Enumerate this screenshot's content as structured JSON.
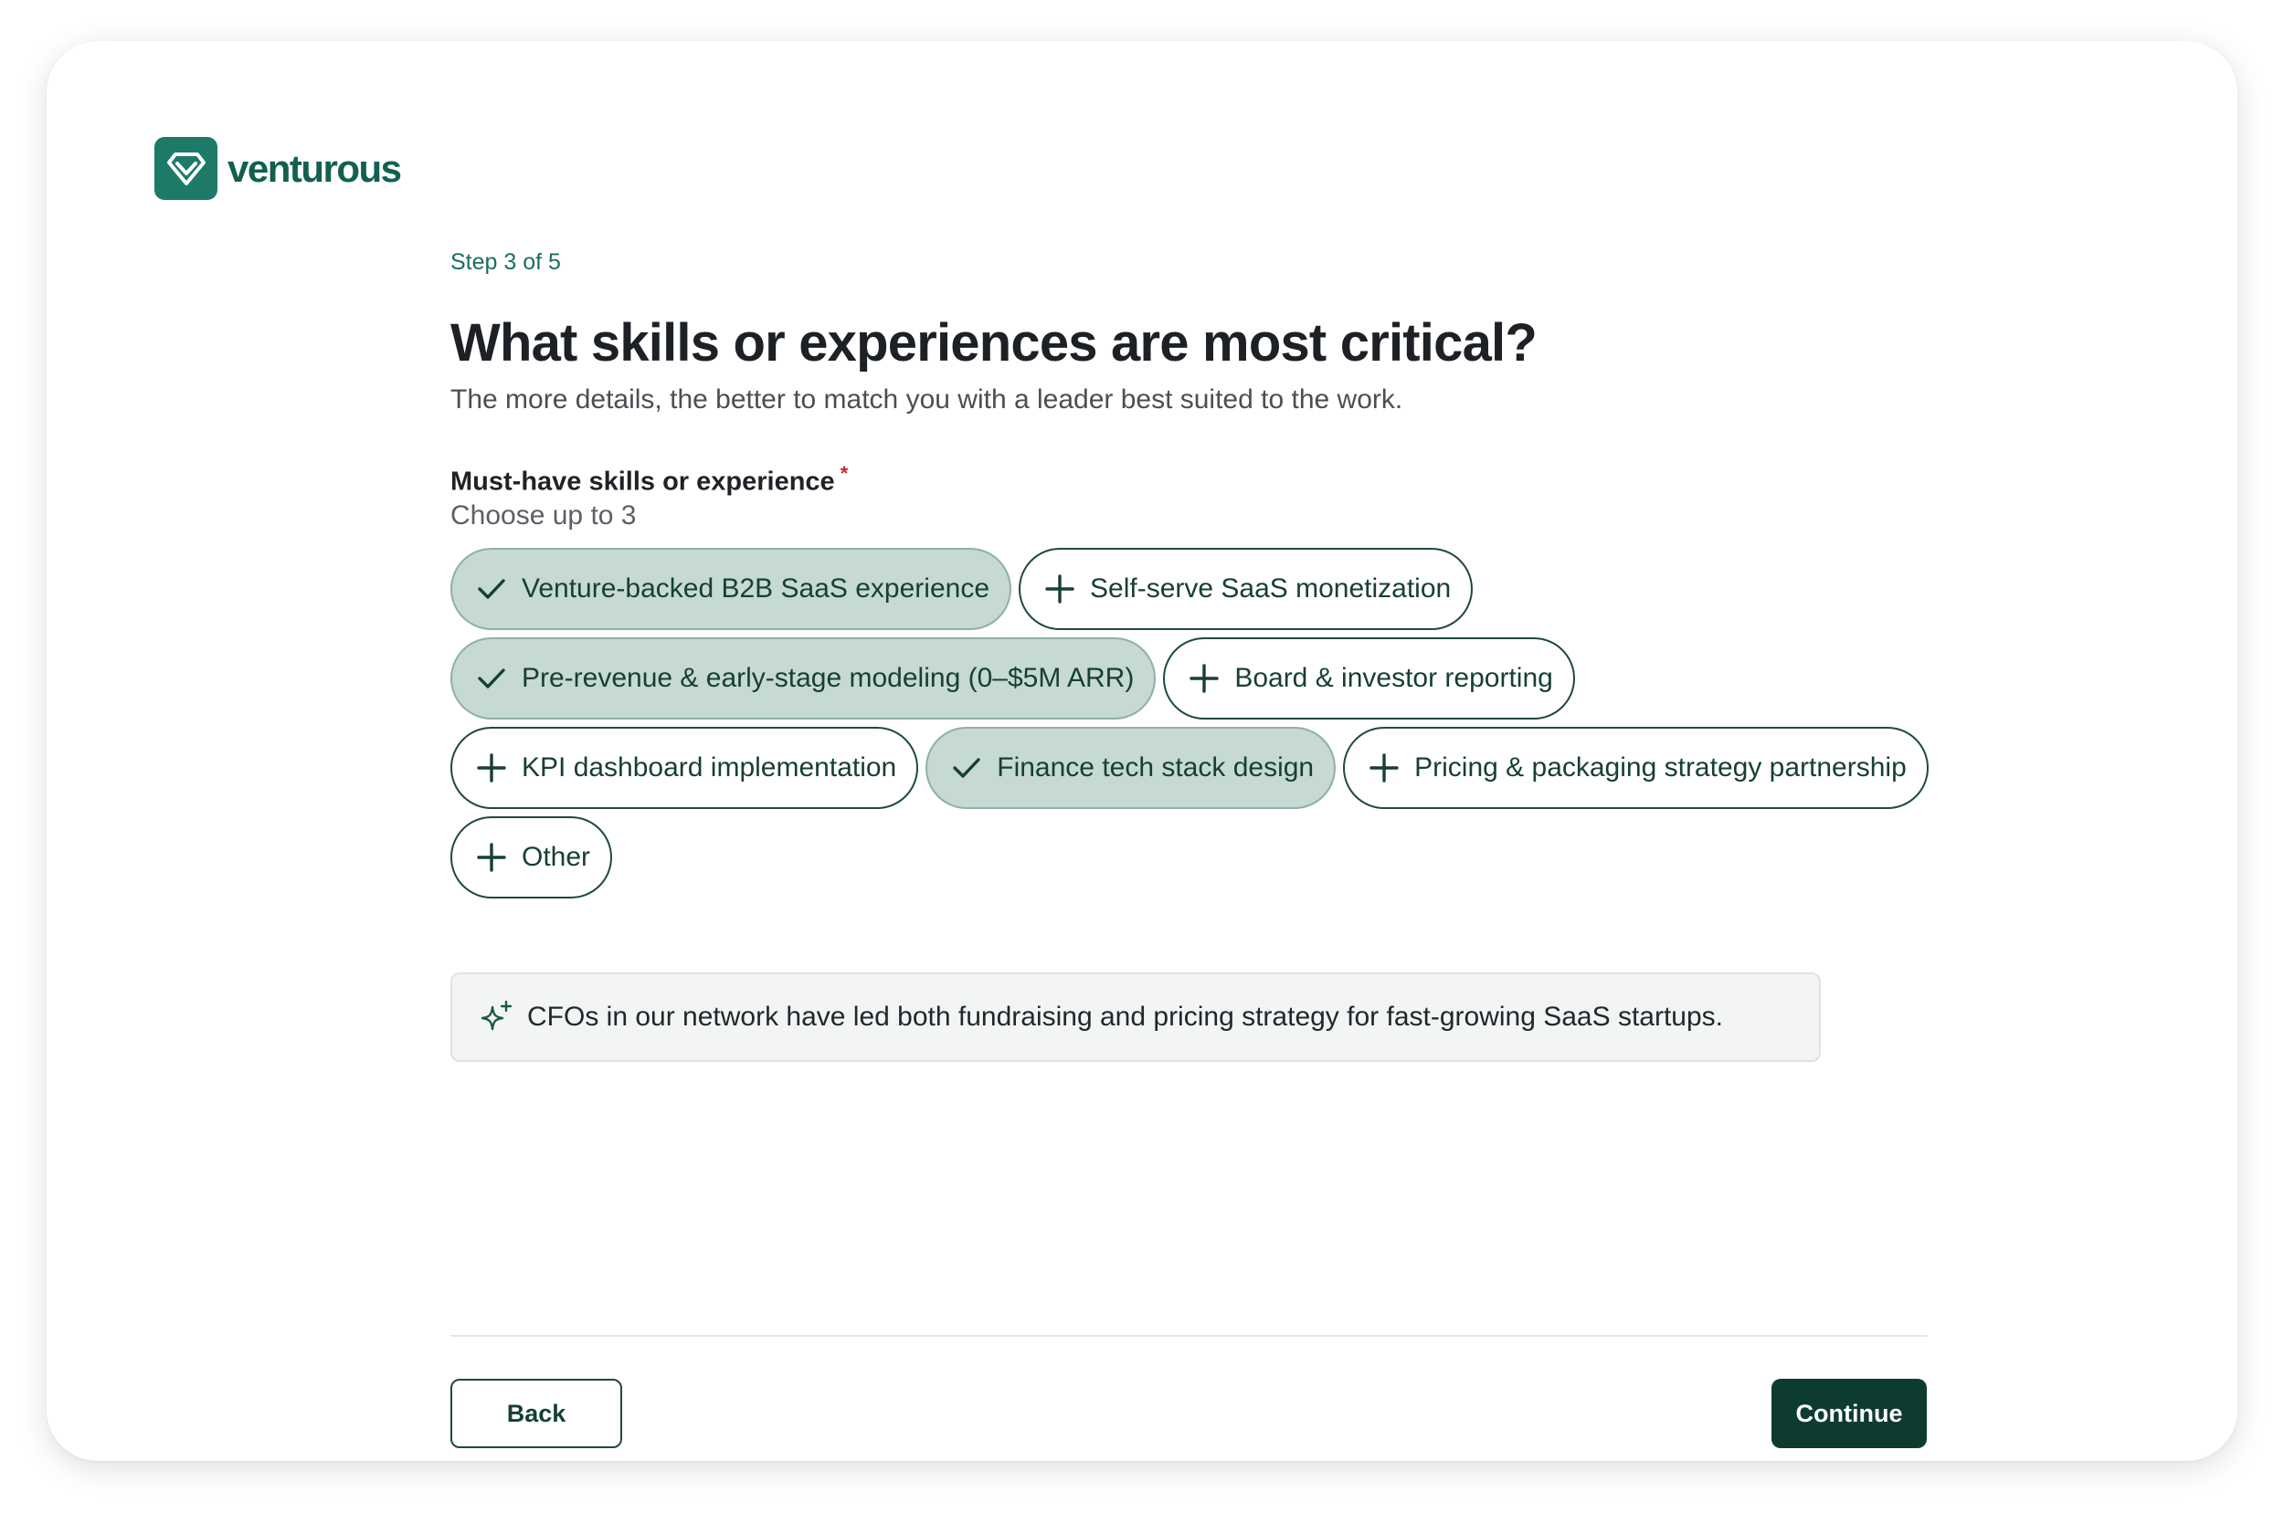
{
  "brand": {
    "name": "venturous",
    "accent": "#1d7a68",
    "dark": "#0e3b30"
  },
  "step": "Step 3 of 5",
  "title": "What skills or experiences are most critical?",
  "subtitle": "The more details, the better to match you with a leader best suited to the work.",
  "field": {
    "label": "Must-have skills or experience",
    "required_marker": "*",
    "hint": "Choose up to 3"
  },
  "chips": [
    {
      "label": "Venture-backed B2B SaaS experience",
      "selected": true,
      "icon": "check-icon"
    },
    {
      "label": "Self-serve SaaS monetization",
      "selected": false,
      "icon": "plus-icon"
    },
    {
      "label": "Pre-revenue & early-stage modeling (0–$5M ARR)",
      "selected": true,
      "icon": "check-icon"
    },
    {
      "label": "Board & investor reporting",
      "selected": false,
      "icon": "plus-icon"
    },
    {
      "label": "KPI dashboard implementation",
      "selected": false,
      "icon": "plus-icon"
    },
    {
      "label": "Finance tech stack design",
      "selected": true,
      "icon": "check-icon"
    },
    {
      "label": "Pricing & packaging strategy partnership",
      "selected": false,
      "icon": "plus-icon"
    },
    {
      "label": "Other",
      "selected": false,
      "icon": "plus-icon"
    }
  ],
  "insight": {
    "icon": "sparkle-icon",
    "text": "CFOs in our network have led both fundraising and pricing strategy for fast-growing SaaS startups."
  },
  "actions": {
    "back": "Back",
    "continue": "Continue"
  }
}
